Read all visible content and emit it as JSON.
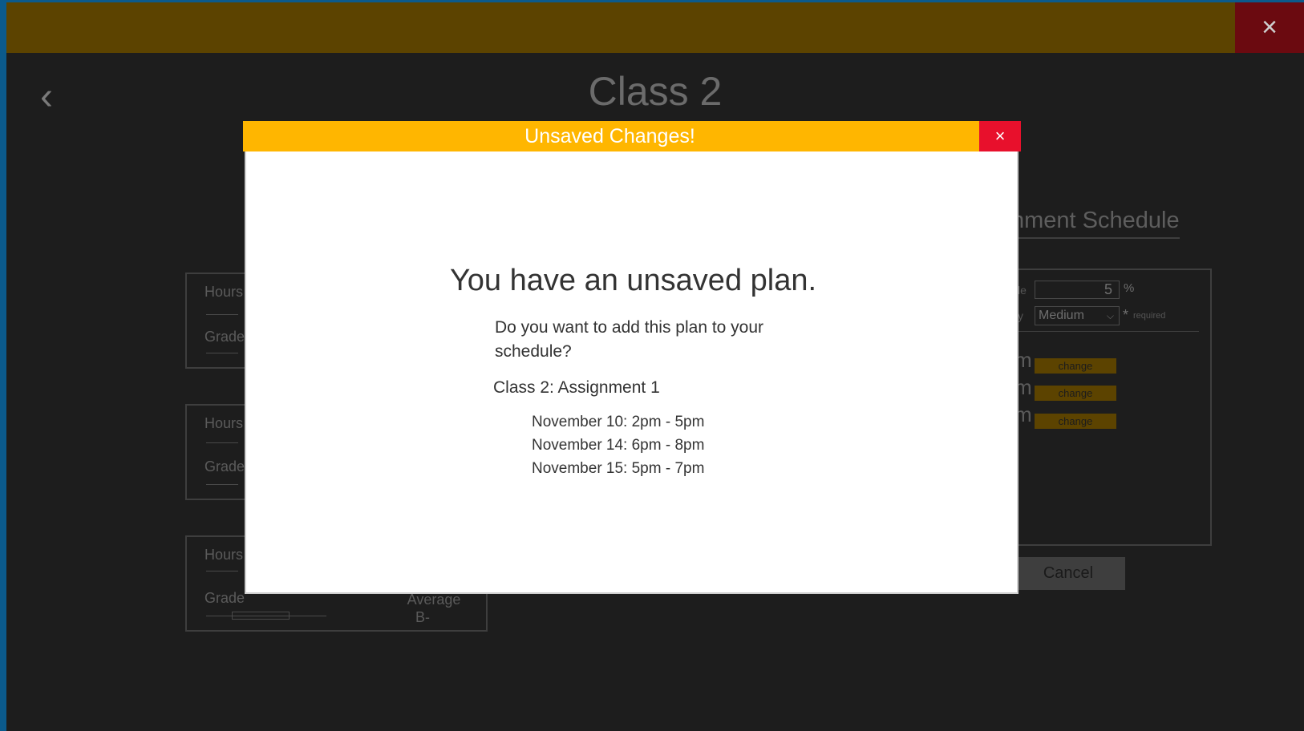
{
  "app": {
    "close_icon": "×",
    "back_icon": "‹",
    "title": "Class 2"
  },
  "cards": [
    {
      "hours_label": "Hours",
      "grade_label": "Grade",
      "average_label": "",
      "average_value": ""
    },
    {
      "hours_label": "Hours",
      "grade_label": "Grade",
      "average_label": "",
      "average_value": ""
    },
    {
      "hours_label": "Hours",
      "grade_label": "Grade",
      "average_label": "Average",
      "average_value": "B-"
    }
  ],
  "schedule": {
    "title": "nment Schedule",
    "weight_label_fragment": "le",
    "weight_value": "5",
    "weight_unit": "%",
    "difficulty_label_fragment": "y",
    "difficulty_value": "Medium",
    "chevron_icon": "⌵",
    "required_star": "*",
    "required_text": "required",
    "rows": [
      {
        "time_fragment": "m",
        "button_label": "change"
      },
      {
        "time_fragment": "m",
        "button_label": "change"
      },
      {
        "time_fragment": "m",
        "button_label": "change"
      }
    ],
    "cancel_label": "Cancel"
  },
  "modal": {
    "title": "Unsaved Changes!",
    "close_icon": "×",
    "heading": "You have an unsaved plan.",
    "question": "Do you want to add this plan to your schedule?",
    "plan_name": "Class 2: Assignment 1",
    "times": [
      "November 10: 2pm - 5pm",
      "November 14: 6pm - 8pm",
      "November 15: 5pm - 7pm"
    ]
  },
  "colors": {
    "modal_header": "#ffb600",
    "modal_close": "#e8102c",
    "topbar": "#5c4300",
    "change_button": "#5c4300"
  }
}
